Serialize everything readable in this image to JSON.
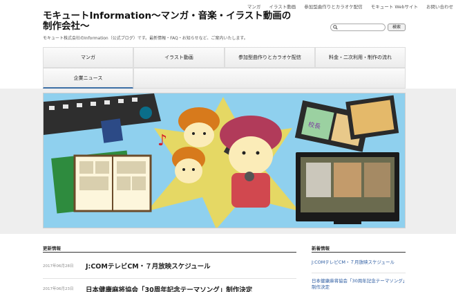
{
  "header": {
    "title": "モキュートInformation～マンガ・音楽・イラスト動画の制作会社～",
    "description": "モキュート株式会社のInformation（公式ブログ）です。最新情報・FAQ・お知らせなど、ご案内いたします。",
    "top_links": [
      "マンガ",
      "イラスト動画",
      "参加型曲作りとカラオケ配信",
      "モキュート Webサイト",
      "お問い合わせ"
    ],
    "search": {
      "placeholder": "",
      "button_label": "検索"
    }
  },
  "nav": {
    "items": [
      "マンガ",
      "イラスト動画",
      "参加型曲作りとカラオケ配信",
      "料金・二次利用・制作の流れ",
      "企業ニュース"
    ]
  },
  "hero": {
    "sign_text": "校長"
  },
  "news": {
    "heading": "更新情報",
    "items": [
      {
        "date": "2017年06月28日",
        "title": "J:COMテレビCM・７月放映スケジュール"
      },
      {
        "date": "2017年06月23日",
        "title": "日本健康麻将協会「30周年記念テーマソング」制作決定"
      }
    ]
  },
  "sidebar": {
    "heading": "新着情報",
    "links": [
      "J:COMテレビCM・７月放映スケジュール",
      "日本健康麻将協会「30周年記念テーマソング」制作決定"
    ]
  },
  "colors": {
    "accent": "#3b6ea5",
    "link": "#2a5aa0",
    "hero_bg": "#8fd0ee",
    "hero_star": "#f5d94b"
  }
}
